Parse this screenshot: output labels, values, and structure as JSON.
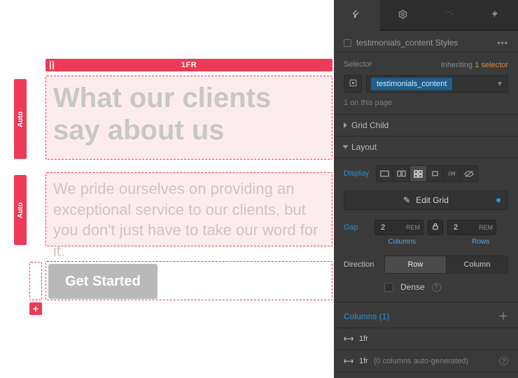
{
  "canvas": {
    "column_header": "1FR",
    "row_label_1": "Auto",
    "row_label_2": "Auto",
    "heading": "What our clients say about us",
    "body": "We pride ourselves on providing an exceptional service to our clients, but you don't just have to take our word for it.",
    "cta": "Get Started"
  },
  "panel": {
    "styles_title": "testimonials_content Styles",
    "selector_label": "Selector",
    "inheriting_label": "Inheriting",
    "inheriting_count": "1 selector",
    "selector_chip": "testimonials_content",
    "on_page": "1 on this page",
    "sect_gridchild": "Grid Child",
    "sect_layout": "Layout",
    "display_label": "Display",
    "edit_grid": "Edit Grid",
    "gap_label": "Gap",
    "gap_col_val": "2",
    "gap_col_unit": "REM",
    "gap_row_val": "2",
    "gap_row_unit": "REM",
    "gap_col_sub": "Columns",
    "gap_row_sub": "Rows",
    "direction_label": "Direction",
    "dir_row": "Row",
    "dir_col": "Column",
    "dense_label": "Dense",
    "columns_header": "Columns (1)",
    "col_item_1": "1fr",
    "col_item_2_prefix": "1fr",
    "col_item_2_suffix": "(0 columns auto-generated)"
  }
}
